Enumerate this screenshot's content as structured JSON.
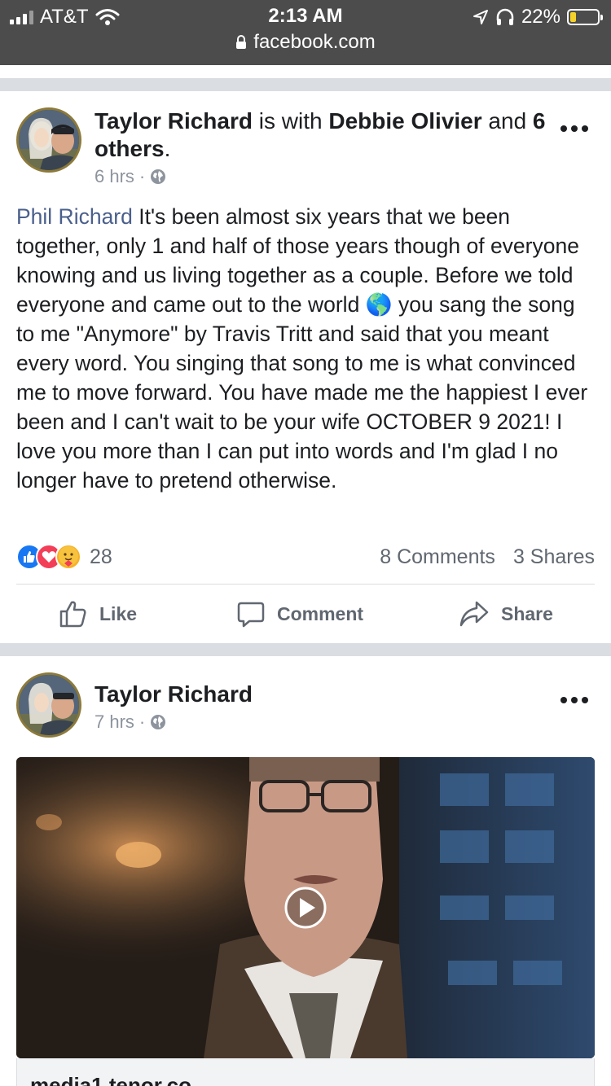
{
  "status_bar": {
    "carrier": "AT&T",
    "time": "2:13 AM",
    "battery_percent": "22%",
    "battery_level": 0.22,
    "battery_color": "#f5d22a",
    "url": "facebook.com",
    "icons": [
      "signal-icon",
      "wifi-icon",
      "location-icon",
      "headphones-icon",
      "battery-icon",
      "lock-icon"
    ]
  },
  "post1": {
    "author": "Taylor Richard",
    "with_text": "is with",
    "tagged": "Debbie Olivier",
    "and_text": "and",
    "others": "6 others",
    "period": ".",
    "time": "6 hrs",
    "time_sep": "·",
    "mention": "Phil Richard",
    "body": " It's been almost six years that we been together, only 1 and half of those years though of everyone knowing and us living together as a couple. Before we told everyone and came out to the world 🌎 you sang the song to me \"Anymore\" by Travis Tritt and said that you meant every word. You singing that song to me is what convinced me to move forward. You have made me the happiest I ever been and I can't wait to be your wife OCTOBER 9 2021! I love you more than I can put into words and I'm glad I no longer have to pretend otherwise.",
    "reactions": [
      "like",
      "love",
      "care"
    ],
    "reaction_count": "28",
    "comments": "8 Comments",
    "shares": "3 Shares"
  },
  "actions": {
    "like": "Like",
    "comment": "Comment",
    "share": "Share"
  },
  "post2": {
    "author": "Taylor Richard",
    "time": "7 hrs",
    "time_sep": "·",
    "caption": "media1.tenor.co"
  },
  "colors": {
    "facebook_link": "#4a5f8c",
    "like_blue": "#1877f2",
    "love_red": "#f33e58",
    "care_yellow": "#f7b125",
    "muted_text": "#606770"
  }
}
